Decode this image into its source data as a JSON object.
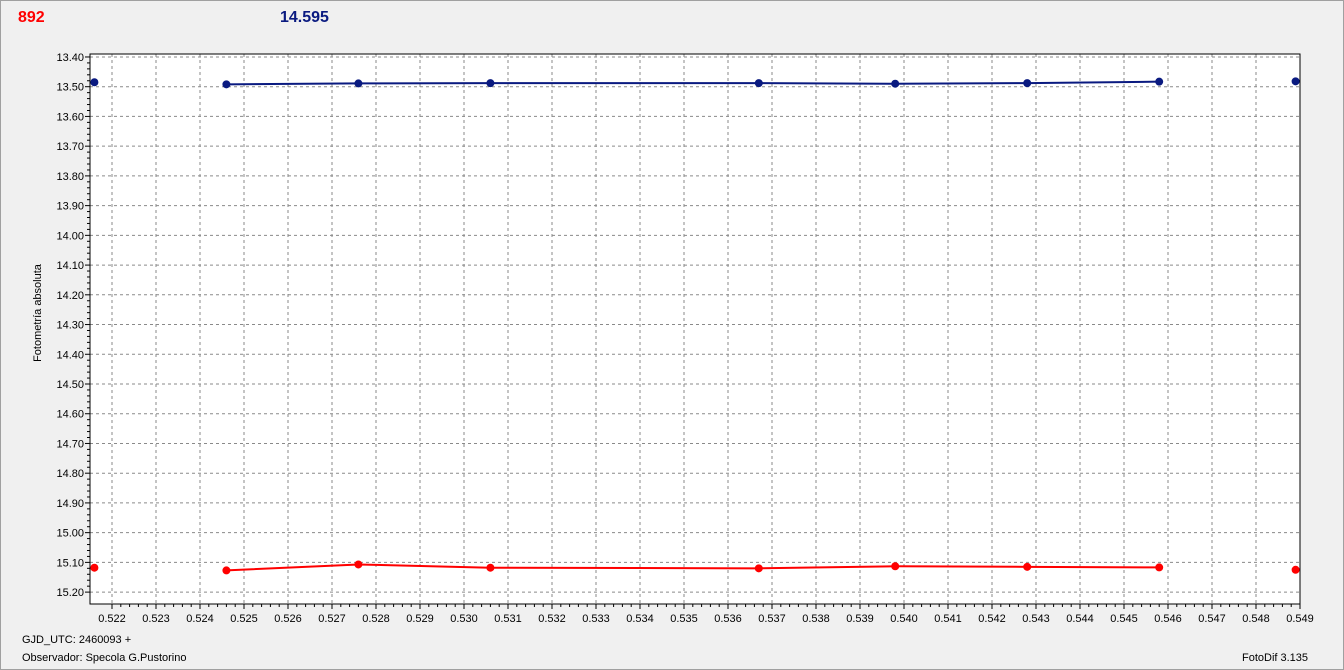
{
  "header": {
    "left_value": "892",
    "right_value": "14.595"
  },
  "footer": {
    "gjd_label": "GJD_UTC: 2460093 +",
    "observer_label": "Observador: Specola G.Pustorino",
    "app_label": "FotoDif 3.135"
  },
  "colors": {
    "series_1": "#0a1a80",
    "series_2": "#ff0000",
    "grid": "#8a8a8a",
    "background": "#ffffff"
  },
  "chart_data": {
    "type": "line",
    "title": "",
    "xlabel": "",
    "ylabel": "Fotometría absoluta",
    "xlim": [
      0.5215,
      0.549
    ],
    "ylim": [
      15.24,
      13.39
    ],
    "y_inverted": true,
    "grid": true,
    "x_ticks": [
      "0.522",
      "0.523",
      "0.524",
      "0.525",
      "0.526",
      "0.527",
      "0.528",
      "0.529",
      "0.530",
      "0.531",
      "0.532",
      "0.533",
      "0.534",
      "0.535",
      "0.536",
      "0.537",
      "0.538",
      "0.539",
      "0.540",
      "0.541",
      "0.542",
      "0.543",
      "0.544",
      "0.545",
      "0.546",
      "0.547",
      "0.548",
      "0.549"
    ],
    "y_ticks": [
      "13.40",
      "13.50",
      "13.60",
      "13.70",
      "13.80",
      "13.90",
      "14.00",
      "14.10",
      "14.20",
      "14.30",
      "14.40",
      "14.50",
      "14.60",
      "14.70",
      "14.80",
      "14.90",
      "15.00",
      "15.10",
      "15.20"
    ],
    "series": [
      {
        "color": "#0a1a80",
        "x": [
          0.5216,
          0.5246,
          0.5276,
          0.5306,
          0.5367,
          0.5398,
          0.5428,
          0.5458,
          0.5489
        ],
        "y": [
          13.485,
          13.492,
          13.489,
          13.488,
          13.488,
          13.49,
          13.488,
          13.483,
          13.482
        ],
        "line_from_index": 1,
        "line_to_index": 7
      },
      {
        "color": "#ff0000",
        "x": [
          0.5216,
          0.5246,
          0.5276,
          0.5306,
          0.5367,
          0.5398,
          0.5428,
          0.5458,
          0.5489
        ],
        "y": [
          15.118,
          15.127,
          15.107,
          15.118,
          15.12,
          15.113,
          15.115,
          15.117,
          15.125
        ],
        "line_from_index": 1,
        "line_to_index": 7
      }
    ]
  }
}
